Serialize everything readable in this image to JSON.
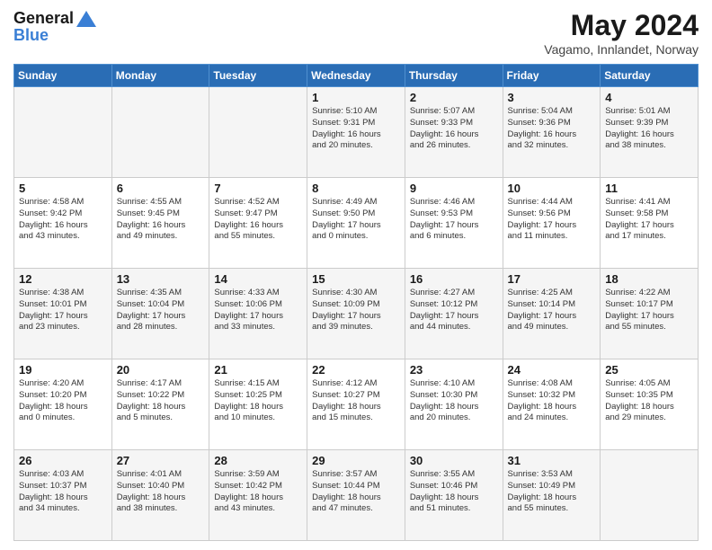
{
  "header": {
    "logo_line1": "General",
    "logo_line2": "Blue",
    "title": "May 2024",
    "subtitle": "Vagamo, Innlandet, Norway"
  },
  "days_of_week": [
    "Sunday",
    "Monday",
    "Tuesday",
    "Wednesday",
    "Thursday",
    "Friday",
    "Saturday"
  ],
  "weeks": [
    [
      {
        "num": "",
        "info": ""
      },
      {
        "num": "",
        "info": ""
      },
      {
        "num": "",
        "info": ""
      },
      {
        "num": "1",
        "info": "Sunrise: 5:10 AM\nSunset: 9:31 PM\nDaylight: 16 hours\nand 20 minutes."
      },
      {
        "num": "2",
        "info": "Sunrise: 5:07 AM\nSunset: 9:33 PM\nDaylight: 16 hours\nand 26 minutes."
      },
      {
        "num": "3",
        "info": "Sunrise: 5:04 AM\nSunset: 9:36 PM\nDaylight: 16 hours\nand 32 minutes."
      },
      {
        "num": "4",
        "info": "Sunrise: 5:01 AM\nSunset: 9:39 PM\nDaylight: 16 hours\nand 38 minutes."
      }
    ],
    [
      {
        "num": "5",
        "info": "Sunrise: 4:58 AM\nSunset: 9:42 PM\nDaylight: 16 hours\nand 43 minutes."
      },
      {
        "num": "6",
        "info": "Sunrise: 4:55 AM\nSunset: 9:45 PM\nDaylight: 16 hours\nand 49 minutes."
      },
      {
        "num": "7",
        "info": "Sunrise: 4:52 AM\nSunset: 9:47 PM\nDaylight: 16 hours\nand 55 minutes."
      },
      {
        "num": "8",
        "info": "Sunrise: 4:49 AM\nSunset: 9:50 PM\nDaylight: 17 hours\nand 0 minutes."
      },
      {
        "num": "9",
        "info": "Sunrise: 4:46 AM\nSunset: 9:53 PM\nDaylight: 17 hours\nand 6 minutes."
      },
      {
        "num": "10",
        "info": "Sunrise: 4:44 AM\nSunset: 9:56 PM\nDaylight: 17 hours\nand 11 minutes."
      },
      {
        "num": "11",
        "info": "Sunrise: 4:41 AM\nSunset: 9:58 PM\nDaylight: 17 hours\nand 17 minutes."
      }
    ],
    [
      {
        "num": "12",
        "info": "Sunrise: 4:38 AM\nSunset: 10:01 PM\nDaylight: 17 hours\nand 23 minutes."
      },
      {
        "num": "13",
        "info": "Sunrise: 4:35 AM\nSunset: 10:04 PM\nDaylight: 17 hours\nand 28 minutes."
      },
      {
        "num": "14",
        "info": "Sunrise: 4:33 AM\nSunset: 10:06 PM\nDaylight: 17 hours\nand 33 minutes."
      },
      {
        "num": "15",
        "info": "Sunrise: 4:30 AM\nSunset: 10:09 PM\nDaylight: 17 hours\nand 39 minutes."
      },
      {
        "num": "16",
        "info": "Sunrise: 4:27 AM\nSunset: 10:12 PM\nDaylight: 17 hours\nand 44 minutes."
      },
      {
        "num": "17",
        "info": "Sunrise: 4:25 AM\nSunset: 10:14 PM\nDaylight: 17 hours\nand 49 minutes."
      },
      {
        "num": "18",
        "info": "Sunrise: 4:22 AM\nSunset: 10:17 PM\nDaylight: 17 hours\nand 55 minutes."
      }
    ],
    [
      {
        "num": "19",
        "info": "Sunrise: 4:20 AM\nSunset: 10:20 PM\nDaylight: 18 hours\nand 0 minutes."
      },
      {
        "num": "20",
        "info": "Sunrise: 4:17 AM\nSunset: 10:22 PM\nDaylight: 18 hours\nand 5 minutes."
      },
      {
        "num": "21",
        "info": "Sunrise: 4:15 AM\nSunset: 10:25 PM\nDaylight: 18 hours\nand 10 minutes."
      },
      {
        "num": "22",
        "info": "Sunrise: 4:12 AM\nSunset: 10:27 PM\nDaylight: 18 hours\nand 15 minutes."
      },
      {
        "num": "23",
        "info": "Sunrise: 4:10 AM\nSunset: 10:30 PM\nDaylight: 18 hours\nand 20 minutes."
      },
      {
        "num": "24",
        "info": "Sunrise: 4:08 AM\nSunset: 10:32 PM\nDaylight: 18 hours\nand 24 minutes."
      },
      {
        "num": "25",
        "info": "Sunrise: 4:05 AM\nSunset: 10:35 PM\nDaylight: 18 hours\nand 29 minutes."
      }
    ],
    [
      {
        "num": "26",
        "info": "Sunrise: 4:03 AM\nSunset: 10:37 PM\nDaylight: 18 hours\nand 34 minutes."
      },
      {
        "num": "27",
        "info": "Sunrise: 4:01 AM\nSunset: 10:40 PM\nDaylight: 18 hours\nand 38 minutes."
      },
      {
        "num": "28",
        "info": "Sunrise: 3:59 AM\nSunset: 10:42 PM\nDaylight: 18 hours\nand 43 minutes."
      },
      {
        "num": "29",
        "info": "Sunrise: 3:57 AM\nSunset: 10:44 PM\nDaylight: 18 hours\nand 47 minutes."
      },
      {
        "num": "30",
        "info": "Sunrise: 3:55 AM\nSunset: 10:46 PM\nDaylight: 18 hours\nand 51 minutes."
      },
      {
        "num": "31",
        "info": "Sunrise: 3:53 AM\nSunset: 10:49 PM\nDaylight: 18 hours\nand 55 minutes."
      },
      {
        "num": "",
        "info": ""
      }
    ]
  ],
  "alt_rows": [
    0,
    2,
    4
  ],
  "colors": {
    "header_bg": "#2a6db5",
    "alt_row_bg": "#f0f0f0",
    "normal_row_bg": "#ffffff"
  }
}
